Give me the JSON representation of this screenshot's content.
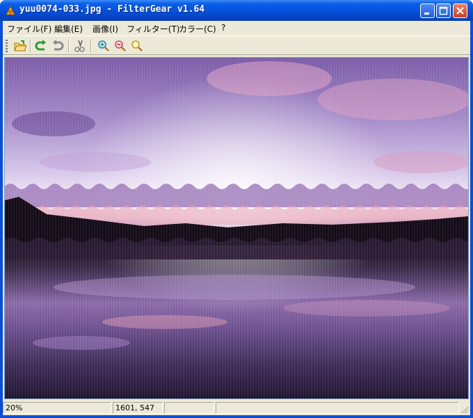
{
  "window": {
    "title": "yuu0074-033.jpg - FilterGear v1.64",
    "controls": [
      "minimize",
      "maximize",
      "close"
    ]
  },
  "menu": {
    "items": [
      {
        "label": "ファイル(F)"
      },
      {
        "label": "編集(E)"
      },
      {
        "label": "画像(I)"
      },
      {
        "label": "フィルター(T)"
      },
      {
        "label": "カラー(C)"
      },
      {
        "label": "?"
      }
    ]
  },
  "toolbar": {
    "tools": [
      "open-icon",
      "undo-icon",
      "redo-icon",
      "cut-icon",
      "zoom-in-icon",
      "zoom-out-icon",
      "zoom-fit-icon"
    ]
  },
  "status": {
    "zoom": "20%",
    "coords": "1601, 547",
    "cell3": "",
    "cell4": ""
  },
  "colors": {
    "title_bar": "#0654e0",
    "window_face": "#ece9d8",
    "sky_top": "#7d5fa8",
    "sky_glow": "#f8eef8",
    "treeline": "#120a14",
    "water_dark": "#2b1c38"
  }
}
